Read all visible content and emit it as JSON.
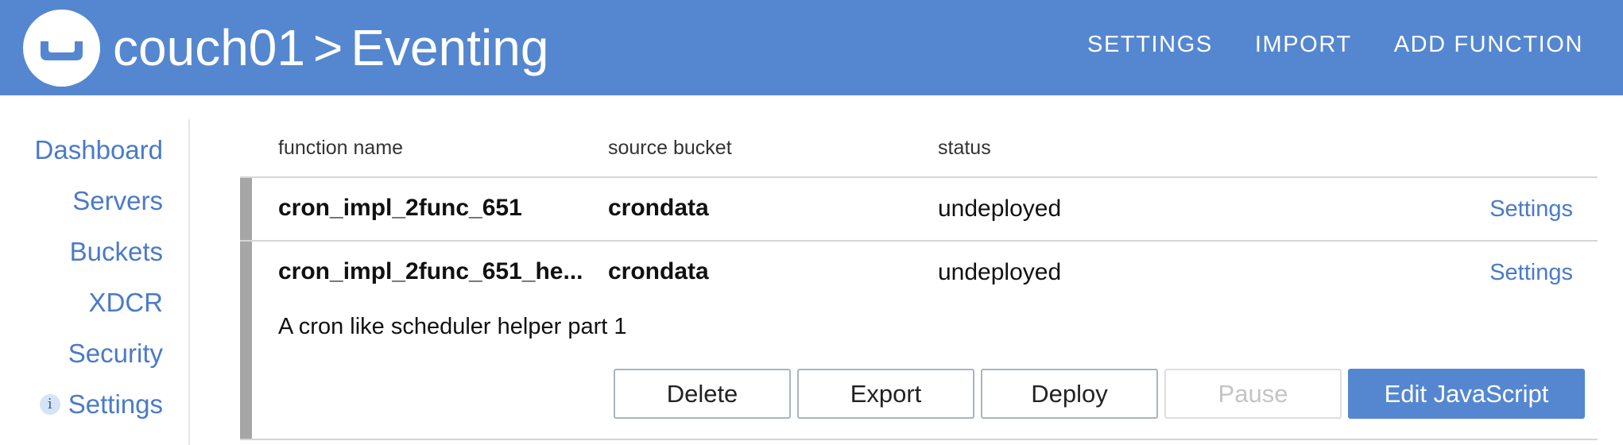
{
  "header": {
    "breadcrumb_cluster": "couch01",
    "breadcrumb_separator": ">",
    "breadcrumb_page": "Eventing",
    "logo_icon": "couchbase-logo-icon",
    "nav": [
      {
        "label": "SETTINGS"
      },
      {
        "label": "IMPORT"
      },
      {
        "label": "ADD FUNCTION"
      }
    ]
  },
  "sidebar": {
    "items": [
      {
        "label": "Dashboard"
      },
      {
        "label": "Servers"
      },
      {
        "label": "Buckets"
      },
      {
        "label": "XDCR"
      },
      {
        "label": "Security"
      },
      {
        "label": "Settings",
        "icon": "info-icon",
        "icon_glyph": "i"
      }
    ]
  },
  "table": {
    "columns": [
      "function name",
      "source bucket",
      "status"
    ],
    "rows": [
      {
        "name": "cron_impl_2func_651",
        "bucket": "crondata",
        "status": "undeployed",
        "action": "Settings"
      },
      {
        "name": "cron_impl_2func_651_he...",
        "bucket": "crondata",
        "status": "undeployed",
        "action": "Settings",
        "description": "A cron like scheduler helper part 1",
        "buttons": {
          "delete": "Delete",
          "export": "Export",
          "deploy": "Deploy",
          "pause": "Pause",
          "edit": "Edit JavaScript"
        }
      }
    ]
  },
  "colors": {
    "accent": "#5587d0",
    "link": "#4a7ac9",
    "row_marker": "#a6a6a6"
  }
}
